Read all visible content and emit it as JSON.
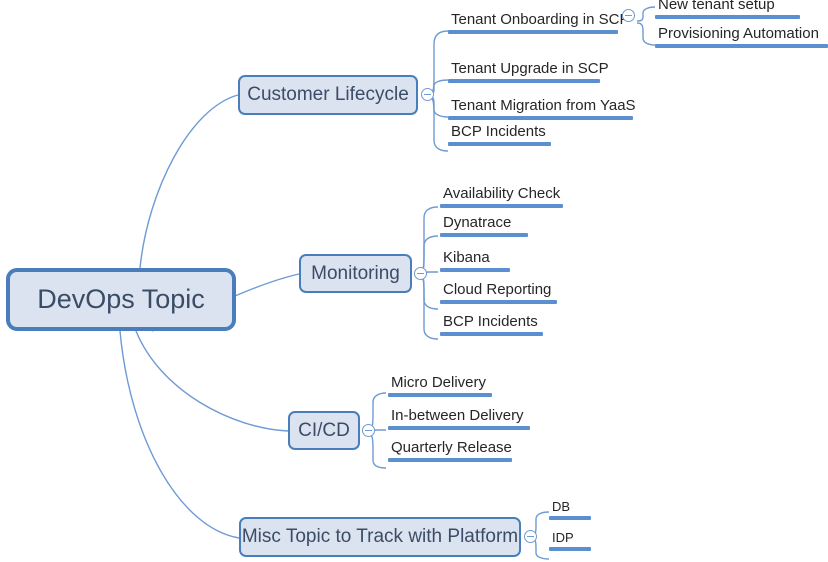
{
  "diagram": {
    "type": "mind-map",
    "colors": {
      "node_fill": "#dce3f0",
      "node_border": "#4a7ebb",
      "edge": "#6f9ad3",
      "leaf_rule": "#5b8fd0",
      "branch_text": "#3b4c66",
      "leaf_text": "#262626",
      "background": "#ffffff"
    },
    "root": {
      "label": "DevOps Topic"
    },
    "branches": [
      {
        "label": "Customer Lifecycle",
        "collapse_icon": "minus-circle-icon",
        "children": [
          {
            "label": "Tenant Onboarding in SCP",
            "collapse_icon": "minus-circle-icon",
            "children": [
              {
                "label": "New tenant setup"
              },
              {
                "label": "Provisioning Automation"
              }
            ]
          },
          {
            "label": "Tenant Upgrade in SCP"
          },
          {
            "label": "Tenant Migration from YaaS"
          },
          {
            "label": "BCP Incidents"
          }
        ]
      },
      {
        "label": "Monitoring",
        "collapse_icon": "minus-circle-icon",
        "children": [
          {
            "label": "Availability Check"
          },
          {
            "label": "Dynatrace"
          },
          {
            "label": "Kibana"
          },
          {
            "label": "Cloud Reporting"
          },
          {
            "label": "BCP Incidents"
          }
        ]
      },
      {
        "label": "CI/CD",
        "collapse_icon": "minus-circle-icon",
        "children": [
          {
            "label": "Micro Delivery"
          },
          {
            "label": "In-between Delivery"
          },
          {
            "label": "Quarterly Release"
          }
        ]
      },
      {
        "label": "Misc Topic to Track with Platform",
        "collapse_icon": "minus-circle-icon",
        "children": [
          {
            "label": "DB"
          },
          {
            "label": "IDP"
          }
        ]
      }
    ]
  }
}
